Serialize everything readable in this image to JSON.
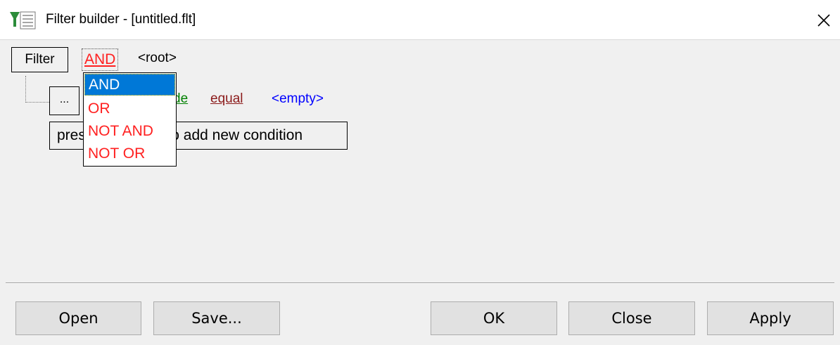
{
  "window": {
    "title": "Filter builder - [untitled.flt]",
    "app_icon": "filter-funnel-icon",
    "close_icon": "close-icon"
  },
  "filter": {
    "filter_label": "Filter",
    "group_operator": "AND",
    "root_label": "<root>"
  },
  "condition": {
    "button_label": "...",
    "field_label": "de",
    "operator_label": "equal",
    "value_label": "<empty>",
    "field_color": "#008000",
    "operator_color": "#8b1a1a",
    "value_color": "#0000ff"
  },
  "add_condition": {
    "label": "press the button to add new condition"
  },
  "operator_dropdown": {
    "selected": "AND",
    "options": [
      "AND",
      "OR",
      "NOT AND",
      "NOT OR"
    ],
    "option_color": "#ff2020",
    "selected_bg": "#0078d7"
  },
  "footer": {
    "open_label": "Open",
    "save_label": "Save...",
    "ok_label": "OK",
    "close_label": "Close",
    "apply_label": "Apply"
  }
}
